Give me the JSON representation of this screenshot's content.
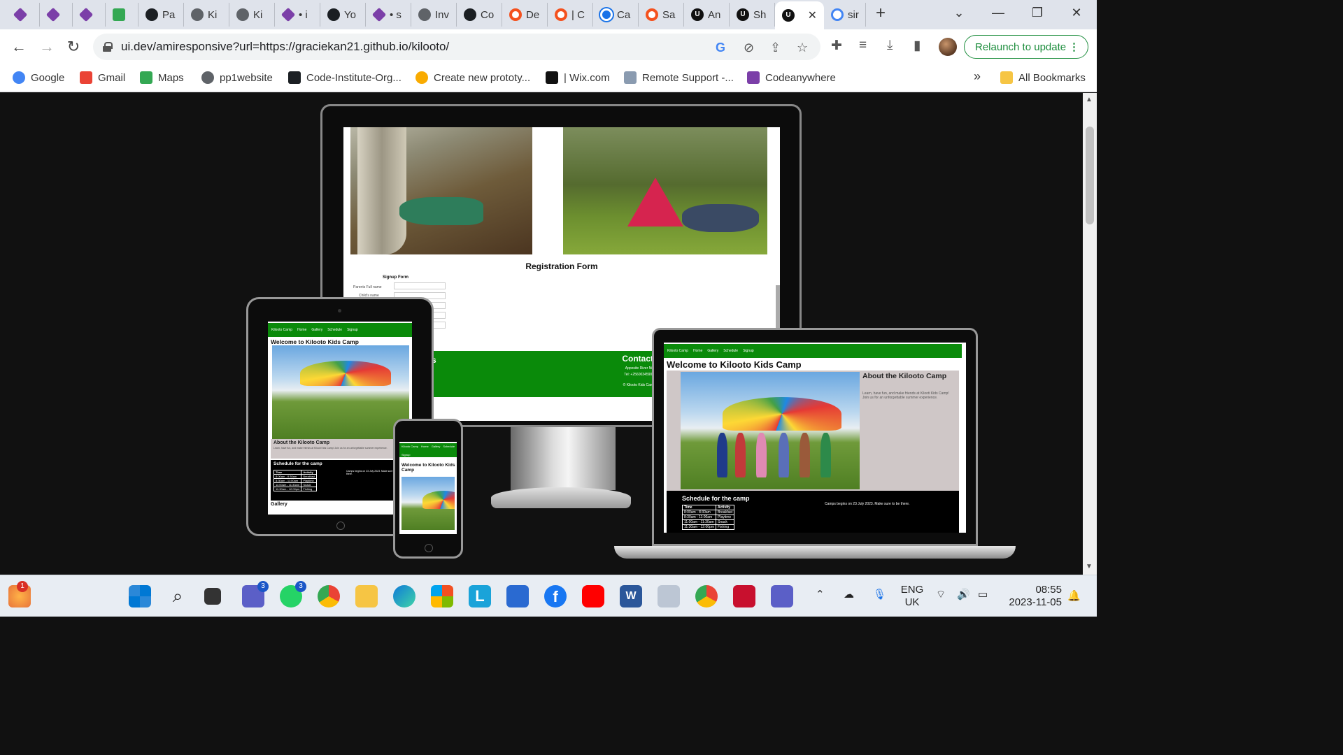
{
  "browser": {
    "tabs": [
      {
        "label": "",
        "icon": "codeanywhere-cube-icon"
      },
      {
        "label": "",
        "icon": "codeanywhere-cube-icon"
      },
      {
        "label": "",
        "icon": "codeanywhere-cube-icon"
      },
      {
        "label": "",
        "icon": "google-meet-icon"
      },
      {
        "label": "Pa",
        "icon": "github-icon"
      },
      {
        "label": "Ki",
        "icon": "globe-icon"
      },
      {
        "label": "Ki",
        "icon": "globe-icon"
      },
      {
        "label": "• i",
        "icon": "codeanywhere-cube-icon"
      },
      {
        "label": "Yo",
        "icon": "github-icon"
      },
      {
        "label": "• s",
        "icon": "codeanywhere-cube-icon"
      },
      {
        "label": "Inv",
        "icon": "globe-icon"
      },
      {
        "label": "Co",
        "icon": "github-icon"
      },
      {
        "label": "De",
        "icon": "ring-icon"
      },
      {
        "label": "| C",
        "icon": "ring-icon"
      },
      {
        "label": "Ca",
        "icon": "c-logo-icon"
      },
      {
        "label": "Sa",
        "icon": "ring-icon"
      },
      {
        "label": "An",
        "icon": "ui-logo-icon"
      },
      {
        "label": "Sh",
        "icon": "ui-logo-icon"
      },
      {
        "label": "",
        "icon": "ui-logo-icon",
        "active": true
      },
      {
        "label": "sir",
        "icon": "google-icon"
      }
    ],
    "new_tab": "+",
    "url": "ui.dev/amiresponsive?url=https://graciekan21.github.io/kilooto/",
    "relaunch_label": "Relaunch to update",
    "bookmarks": [
      {
        "label": "Google",
        "icon": "google-icon"
      },
      {
        "label": "Gmail",
        "icon": "gmail-icon"
      },
      {
        "label": "Maps",
        "icon": "maps-icon"
      },
      {
        "label": "pp1website",
        "icon": "globe-icon"
      },
      {
        "label": "Code-Institute-Org...",
        "icon": "github-icon"
      },
      {
        "label": "Create new prototy...",
        "icon": "smiley-icon"
      },
      {
        "label": "| Wix.com",
        "icon": "wix-icon"
      },
      {
        "label": "Remote Support -...",
        "icon": "remote-support-icon"
      },
      {
        "label": "Codeanywhere",
        "icon": "codeanywhere-cube-icon"
      }
    ],
    "bookmarks_overflow": "»",
    "all_bookmarks": "All Bookmarks"
  },
  "site": {
    "nav": [
      "Kilooto Camp",
      "Home",
      "Gallery",
      "Schedule",
      "Signup"
    ],
    "welcome": "Welcome to Kilooto Kids Camp",
    "about_title_tablet": "About the Kilooto Camp",
    "about_title_laptop": "About the Kilooto Camp",
    "about_text": "Learn, have fun, and make friends at Kilooti Kids Camp! Join us for an unforgettable summer experience.",
    "schedule_title": "Schedule for the camp",
    "camp_begins": "Camps begins on 23 July 2023. Make sure to be there.",
    "schedule_header": [
      "Time",
      "Activity"
    ],
    "schedule_rows": [
      [
        "8:00am - 8:30am",
        "Breakfast"
      ],
      [
        "8:30am - 11:00am",
        "Playtime"
      ],
      [
        "11:00am - 11:30am",
        "Snack"
      ],
      [
        "11:30am - 12:00pm",
        "Fishing"
      ]
    ],
    "gallery": "Gallery",
    "registration_form": "Registration Form",
    "signup_form": "Signup Form",
    "parents_full_name": "Parents Full name",
    "childs_name": "Child's name",
    "contacts_title": "Contacts",
    "contacts_address": "Apposite River Nile",
    "contacts_tel": "Tel: +256003459034",
    "contacts_copy": "© Kilooto Kids Camps",
    "footer_left": "s"
  },
  "taskbar": {
    "weather_badge": "1",
    "teams_badge": "3",
    "whatsapp_badge": "3",
    "lang": "ENG",
    "region": "UK",
    "time": "08:55",
    "date": "2023-11-05"
  }
}
